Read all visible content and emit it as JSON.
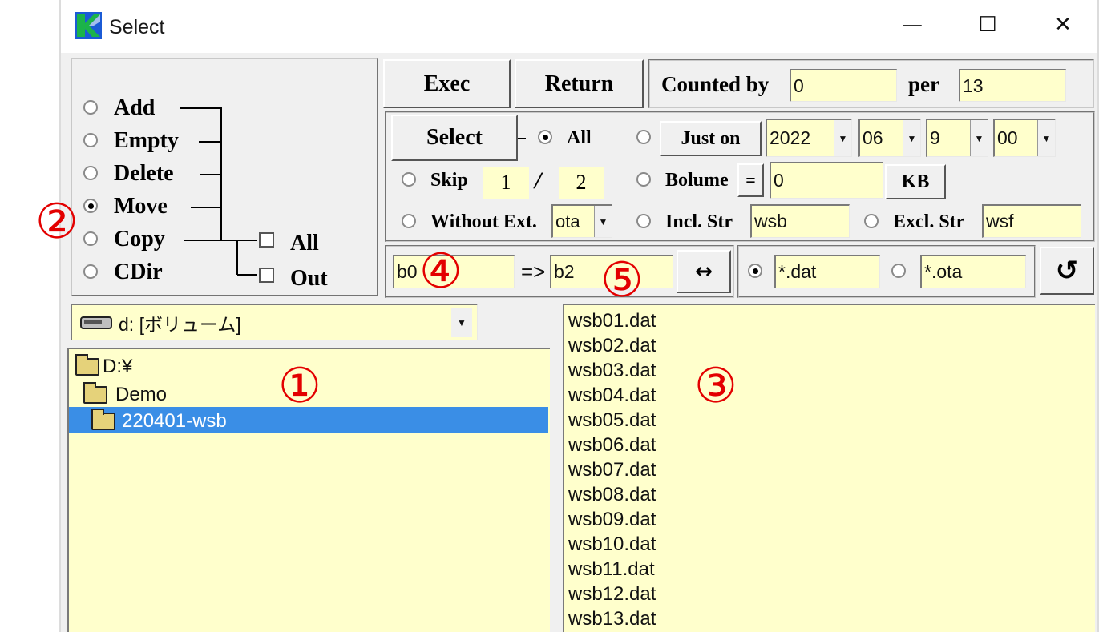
{
  "window": {
    "title": "Select",
    "controls": {
      "minimize": "—",
      "maximize": "☐",
      "close": "✕"
    }
  },
  "mode": {
    "options": [
      "Add",
      "Empty",
      "Delete",
      "Move",
      "Copy",
      "CDir"
    ],
    "selected": "Move",
    "checkboxes": [
      "All",
      "Out"
    ]
  },
  "toolbar": {
    "exec_label": "Exec",
    "return_label": "Return",
    "counted_by_label": "Counted by",
    "counted_by_value": "0",
    "per_label": "per",
    "per_value": "13"
  },
  "select": {
    "select_label": "Select",
    "all_label": "All",
    "just_on_label": "Just on",
    "year": "2022",
    "month": "06",
    "day": "9",
    "hour": "00",
    "skip_label": "Skip",
    "skip_a": "1",
    "skip_sep": "/",
    "skip_b": "2",
    "bolume_label": "Bolume",
    "bolume_op": "=",
    "bolume_value": "0",
    "kb_label": "KB",
    "without_ext_label": "Without Ext.",
    "without_ext_value": "ota",
    "incl_label": "Incl. Str",
    "incl_value": "wsb",
    "excl_label": "Excl. Str",
    "excl_value": "wsf"
  },
  "rename": {
    "from_value": "b0",
    "arrow": "=>",
    "to_value": "b2",
    "swap_label": "↔",
    "pattern1": "*.dat",
    "pattern2": "*.ota",
    "refresh_icon": "↺"
  },
  "drive": {
    "label": "d: [ボリューム]"
  },
  "tree": {
    "items": [
      {
        "label": "D:¥",
        "depth": 0,
        "selected": false
      },
      {
        "label": "Demo",
        "depth": 1,
        "selected": false
      },
      {
        "label": "220401-wsb",
        "depth": 2,
        "selected": true
      }
    ]
  },
  "files": {
    "items": [
      "wsb01.dat",
      "wsb02.dat",
      "wsb03.dat",
      "wsb04.dat",
      "wsb05.dat",
      "wsb06.dat",
      "wsb07.dat",
      "wsb08.dat",
      "wsb09.dat",
      "wsb10.dat",
      "wsb11.dat",
      "wsb12.dat",
      "wsb13.dat"
    ]
  },
  "annotations": {
    "n1": "①",
    "n2": "②",
    "n3": "③",
    "n4": "④",
    "n5": "⑤"
  },
  "colors": {
    "field_bg": "#ffffcc",
    "selection": "#3a8ee6",
    "annotation": "#e30000",
    "icon_green": "#1bb34a",
    "icon_blue": "#1b5bd6"
  }
}
